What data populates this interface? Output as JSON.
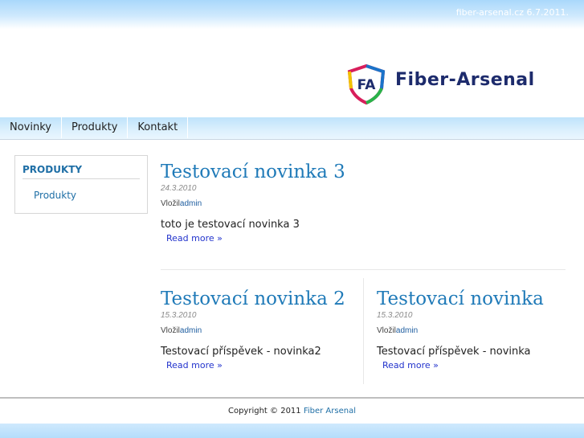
{
  "topbar": {
    "info": "fiber-arsenal.cz 6.7.2011."
  },
  "logo": {
    "monogram": "FA",
    "brand": "Fiber-Arsenal"
  },
  "nav": [
    {
      "label": "Novinky"
    },
    {
      "label": "Produkty"
    },
    {
      "label": "Kontakt"
    }
  ],
  "sidebar": {
    "title": "PRODUKTY",
    "items": [
      {
        "label": "Produkty"
      }
    ]
  },
  "posts": [
    {
      "title": "Testovací novinka 3",
      "date": "24.3.2010",
      "author_prefix": "Vložil",
      "author": "admin",
      "body": "toto je testovací novinka 3",
      "more": "Read more »"
    },
    {
      "title": "Testovací novinka 2",
      "date": "15.3.2010",
      "author_prefix": "Vložil",
      "author": "admin",
      "body": "Testovací příspěvek - novinka2",
      "more": "Read more »"
    },
    {
      "title": "Testovací novinka",
      "date": "15.3.2010",
      "author_prefix": "Vložil",
      "author": "admin",
      "body": "Testovací příspěvek - novinka",
      "more": "Read more »"
    }
  ],
  "footer": {
    "prefix": "Copyright © 2011",
    "brand": "Fiber Arsenal"
  },
  "colors": {
    "accent": "#1f7ab8",
    "link": "#2233cc",
    "brand_navy": "#1d2b6c"
  }
}
